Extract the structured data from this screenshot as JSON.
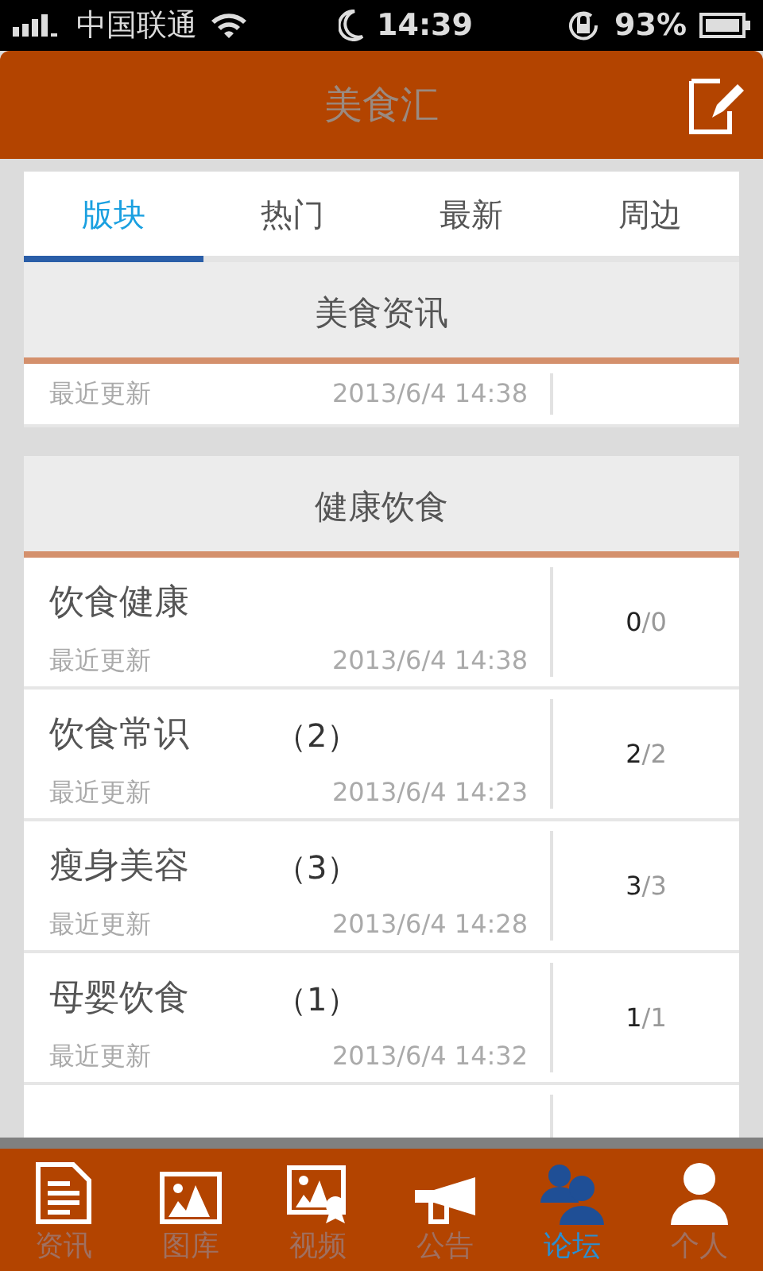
{
  "status_bar": {
    "carrier": "中国联通",
    "time": "14:39",
    "battery": "93%"
  },
  "header": {
    "title": "美食汇"
  },
  "tabs": [
    {
      "label": "版块",
      "selected": true
    },
    {
      "label": "热门",
      "selected": false
    },
    {
      "label": "最新",
      "selected": false
    },
    {
      "label": "周边",
      "selected": false
    }
  ],
  "sections": [
    {
      "title": "美食资讯",
      "rows": [
        {
          "kind": "partial",
          "meta_label": "最近更新",
          "updated": "2013/6/4 14:38"
        }
      ]
    },
    {
      "title": "健康饮食",
      "rows": [
        {
          "kind": "full",
          "name": "饮食健康",
          "meta_label": "最近更新",
          "updated": "2013/6/4 14:38",
          "count_main": "0",
          "count_sub": "/0"
        },
        {
          "kind": "full",
          "name": "饮食常识",
          "badge": "（2）",
          "meta_label": "最近更新",
          "updated": "2013/6/4 14:23",
          "count_main": "2",
          "count_sub": "/2"
        },
        {
          "kind": "full",
          "name": "瘦身美容",
          "badge": "（3）",
          "meta_label": "最近更新",
          "updated": "2013/6/4 14:28",
          "count_main": "3",
          "count_sub": "/3"
        },
        {
          "kind": "full",
          "name": "母婴饮食",
          "badge": "（1）",
          "meta_label": "最近更新",
          "updated": "2013/6/4 14:32",
          "count_main": "1",
          "count_sub": "/1"
        },
        {
          "kind": "cut"
        }
      ]
    }
  ],
  "bottom_nav": [
    {
      "label": "资讯",
      "selected": false
    },
    {
      "label": "图库",
      "selected": false
    },
    {
      "label": "视频",
      "selected": false
    },
    {
      "label": "公告",
      "selected": false
    },
    {
      "label": "论坛",
      "selected": true
    },
    {
      "label": "个人",
      "selected": false
    }
  ]
}
